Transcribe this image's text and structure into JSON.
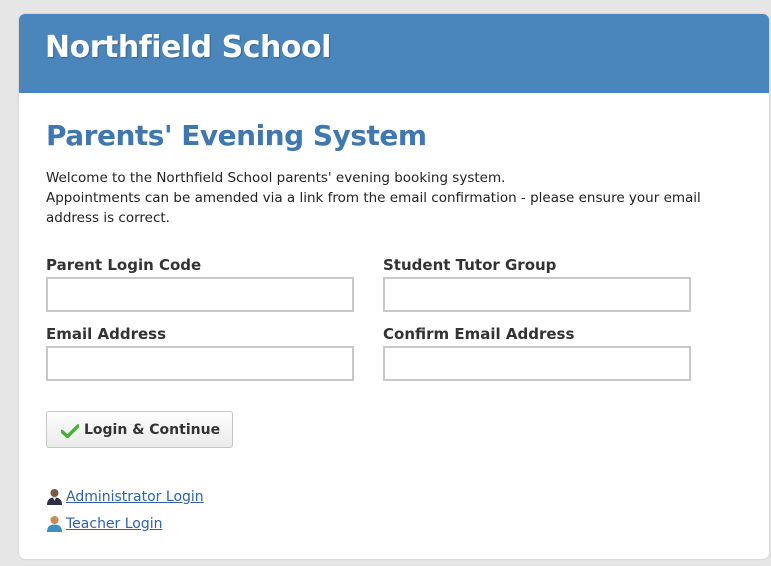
{
  "header": {
    "school_name": "Northfield School"
  },
  "main": {
    "title": "Parents' Evening System",
    "intro_line1": "Welcome to the Northfield School parents' evening booking system.",
    "intro_line2": "Appointments can be amended via a link from the email confirmation - please ensure your email address is correct."
  },
  "form": {
    "parent_login_code_label": "Parent Login Code",
    "parent_login_code_value": "",
    "student_tutor_group_label": "Student Tutor Group",
    "student_tutor_group_value": "",
    "email_address_label": "Email Address",
    "email_address_value": "",
    "confirm_email_address_label": "Confirm Email Address",
    "confirm_email_address_value": "",
    "login_button_label": "Login & Continue"
  },
  "links": {
    "administrator_login": "Administrator Login",
    "teacher_login": "Teacher Login"
  },
  "colors": {
    "header_bg": "#4a85bb",
    "title_color": "#3f78b0",
    "link_color": "#2f62a6",
    "check_color": "#4caf3a"
  },
  "icons": {
    "login_button_icon": "check-icon",
    "administrator_icon": "admin-user-icon",
    "teacher_icon": "teacher-user-icon"
  }
}
